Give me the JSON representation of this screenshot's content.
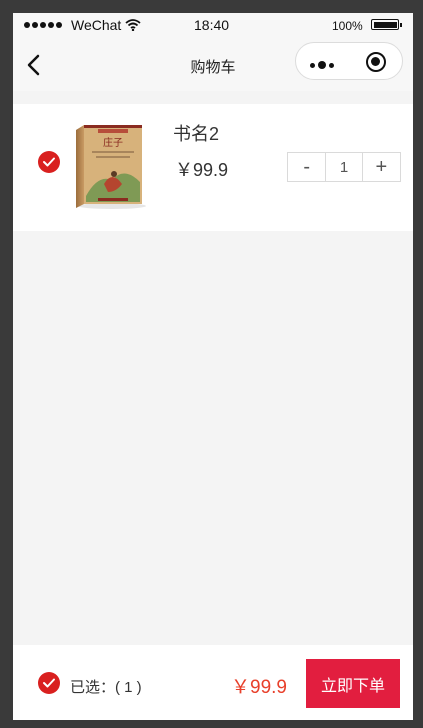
{
  "status_bar": {
    "carrier": "WeChat",
    "time": "18:40",
    "battery": "100%"
  },
  "nav": {
    "title": "购物车"
  },
  "cart": {
    "items": [
      {
        "name": "书名2",
        "price": "￥99.9",
        "quantity": "1",
        "minus_label": "-",
        "plus_label": "+",
        "checked": true,
        "cover_title": "庄子"
      }
    ]
  },
  "footer": {
    "selected_label": "已选：( 1 )",
    "total": "￥99.9",
    "order_button": "立即下单"
  },
  "colors": {
    "accent_red": "#d9201f",
    "price_red": "#e8402b",
    "order_button": "#e21e3f"
  }
}
